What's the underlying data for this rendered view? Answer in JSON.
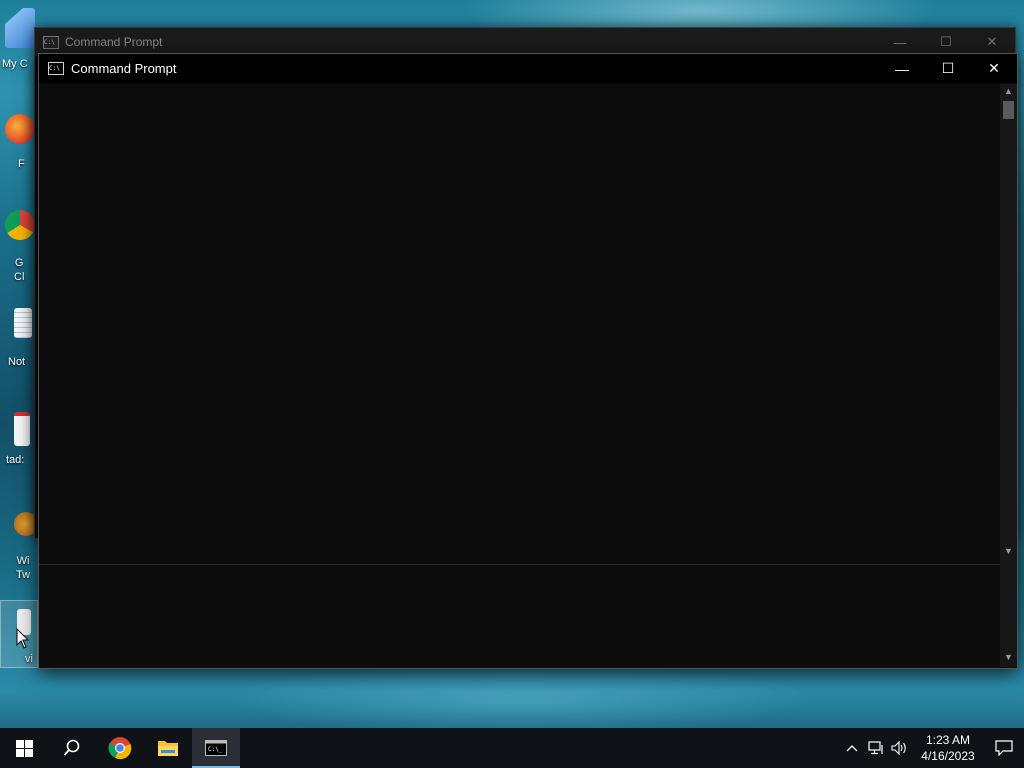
{
  "desktop": {
    "icons": [
      {
        "label": "My C"
      },
      {
        "label": "F"
      },
      {
        "label": "G\nCl"
      },
      {
        "label": "Not"
      },
      {
        "label": "tad:"
      },
      {
        "label": "Wi\nTw"
      },
      {
        "label": "vi"
      }
    ]
  },
  "back_window": {
    "title": "Command Prompt",
    "minimize": "—",
    "maximize": "☐",
    "close": "✕"
  },
  "front_window": {
    "title": "Command Prompt",
    "minimize": "—",
    "maximize": "☐",
    "close": "✕",
    "console_text": ""
  },
  "taskbar": {
    "apps": [
      {
        "name": "start",
        "icon": "windows-logo-icon"
      },
      {
        "name": "search",
        "icon": "search-icon"
      },
      {
        "name": "chrome",
        "icon": "chrome-icon"
      },
      {
        "name": "file-explorer",
        "icon": "folder-icon"
      },
      {
        "name": "command-prompt",
        "icon": "cmd-icon",
        "active": true
      }
    ],
    "clock_time": "1:23 AM",
    "clock_date": "4/16/2023"
  },
  "colors": {
    "taskbar_bg": "#0f1216",
    "console_bg": "#0c0c0c",
    "active_indicator": "#76b9ed"
  }
}
